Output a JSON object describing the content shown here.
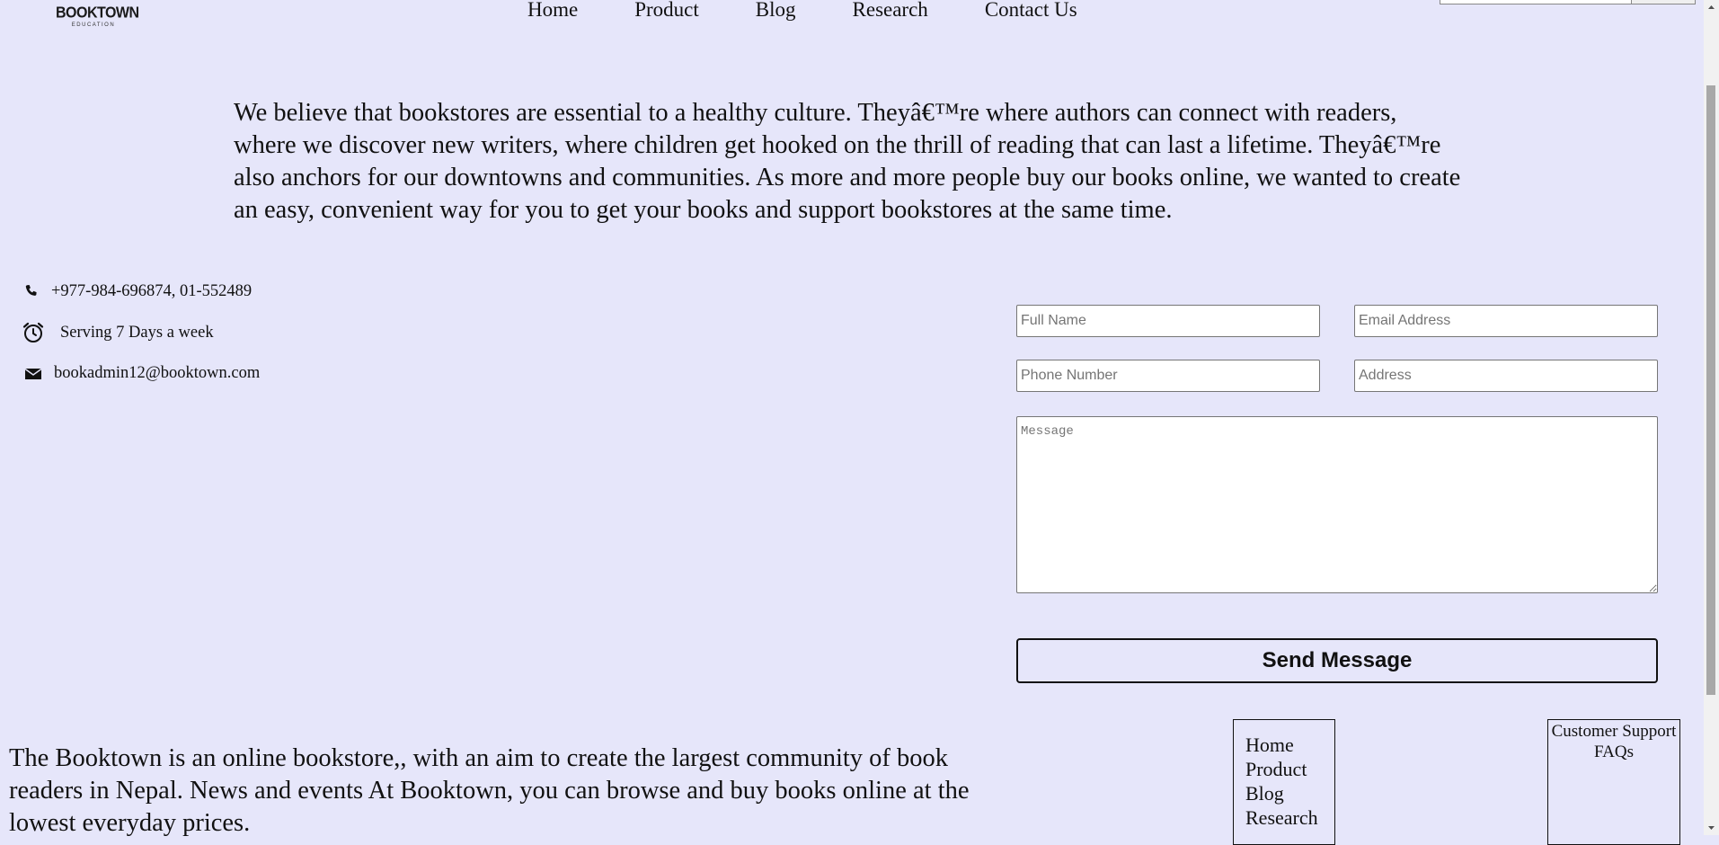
{
  "header": {
    "logo": {
      "main": "BOOKTOWN",
      "sub": "EDUCATION"
    },
    "nav": [
      "Home",
      "Product",
      "Blog",
      "Research",
      "Contact Us"
    ]
  },
  "intro_text": "We believe that bookstores are essential to a healthy culture. Theyâ€™re where authors can connect with readers, where we discover new writers, where children get hooked on the thrill of reading that can last a lifetime. Theyâ€™re also anchors for our downtowns and communities. As more and more people buy our books online, we wanted to create an easy, convenient way for you to get your books and support bookstores at the same time.",
  "contact": {
    "phone": "+977-984-696874, 01-552489",
    "hours": "Serving 7 Days a week",
    "email": "bookadmin12@booktown.com"
  },
  "form": {
    "full_name_placeholder": "Full Name",
    "email_placeholder": "Email Address",
    "phone_placeholder": "Phone Number",
    "address_placeholder": "Address",
    "message_placeholder": "Message",
    "submit_label": "Send Message"
  },
  "about_text": "The Booktown is an online bookstore,, with an aim to create the largest community of book readers in Nepal. News and events At Booktown, you can browse and buy books online at the lowest everyday prices.",
  "footer": {
    "links": [
      "Home",
      "Product",
      "Blog",
      "Research"
    ],
    "support": [
      "Customer Support",
      "FAQs"
    ]
  },
  "colors": {
    "background": "#e6e6fa",
    "text": "#111111"
  },
  "icons": {
    "phone": "phone-icon",
    "hours": "alarm-clock-icon",
    "email": "envelope-icon"
  }
}
